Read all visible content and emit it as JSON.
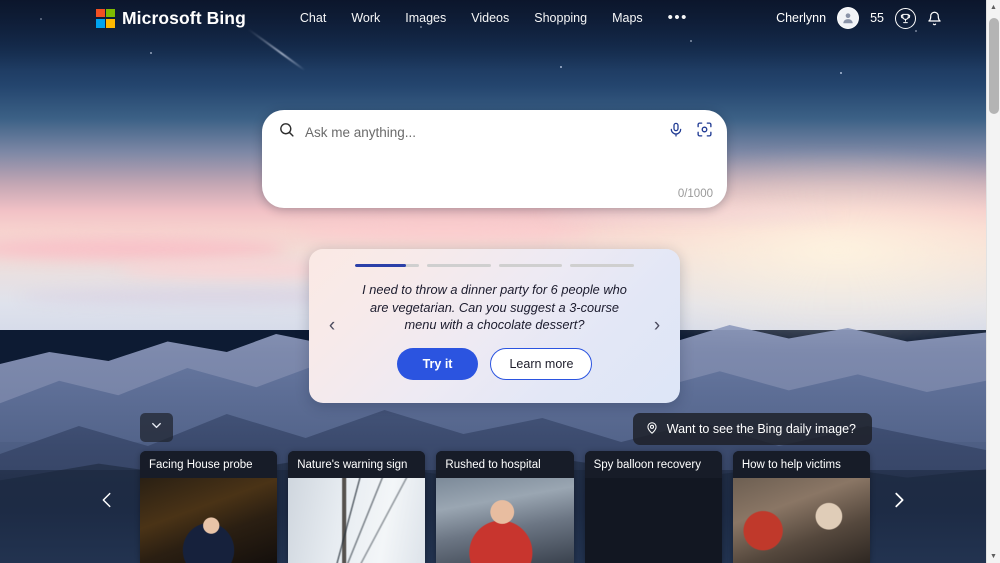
{
  "header": {
    "brand": "Microsoft Bing",
    "logo_colors": [
      "#f25022",
      "#7fba00",
      "#00a4ef",
      "#ffb900"
    ],
    "nav": [
      {
        "label": "Chat",
        "name": "nav-chat"
      },
      {
        "label": "Work",
        "name": "nav-work"
      },
      {
        "label": "Images",
        "name": "nav-images"
      },
      {
        "label": "Videos",
        "name": "nav-videos"
      },
      {
        "label": "Shopping",
        "name": "nav-shopping"
      },
      {
        "label": "Maps",
        "name": "nav-maps"
      }
    ],
    "more_label": "•••",
    "user_name": "Cherlynn",
    "rewards_points": "55",
    "icons": {
      "avatar": "person-avatar-icon",
      "rewards": "trophy-icon",
      "notifications": "bell-icon",
      "menu": "hamburger-menu-icon"
    }
  },
  "search": {
    "placeholder": "Ask me anything...",
    "value": "",
    "char_counter": "0/1000",
    "icons": {
      "search": "search-icon",
      "mic": "microphone-icon",
      "lens": "visual-search-camera-icon"
    }
  },
  "suggestion_card": {
    "text": "I need to throw a dinner party for 6 people who are vegetarian. Can you suggest a 3-course menu with a chocolate dessert?",
    "progress": [
      80,
      0,
      0,
      0
    ],
    "active_index": 0,
    "primary_button": "Try it",
    "secondary_button": "Learn more",
    "prev_label": "‹",
    "next_label": "›",
    "accent_color": "#2b54e0",
    "progress_fill_color": "#2b3fa8"
  },
  "daily_image_button": {
    "label": "Want to see the Bing daily image?",
    "icon": "location-pin-icon"
  },
  "collapse_toggle": {
    "icon": "chevron-down-icon"
  },
  "news": {
    "prev_label": "‹",
    "next_label": "›",
    "cards": [
      {
        "title": "Facing House probe",
        "thumb_class": "t1"
      },
      {
        "title": "Nature's warning sign",
        "thumb_class": "t2"
      },
      {
        "title": "Rushed to hospital",
        "thumb_class": "t3"
      },
      {
        "title": "Spy balloon recovery",
        "thumb_class": "t4b"
      },
      {
        "title": "How to help victims",
        "thumb_class": "t5"
      }
    ]
  },
  "scrollbar": {
    "up": "▲",
    "down": "▼"
  }
}
